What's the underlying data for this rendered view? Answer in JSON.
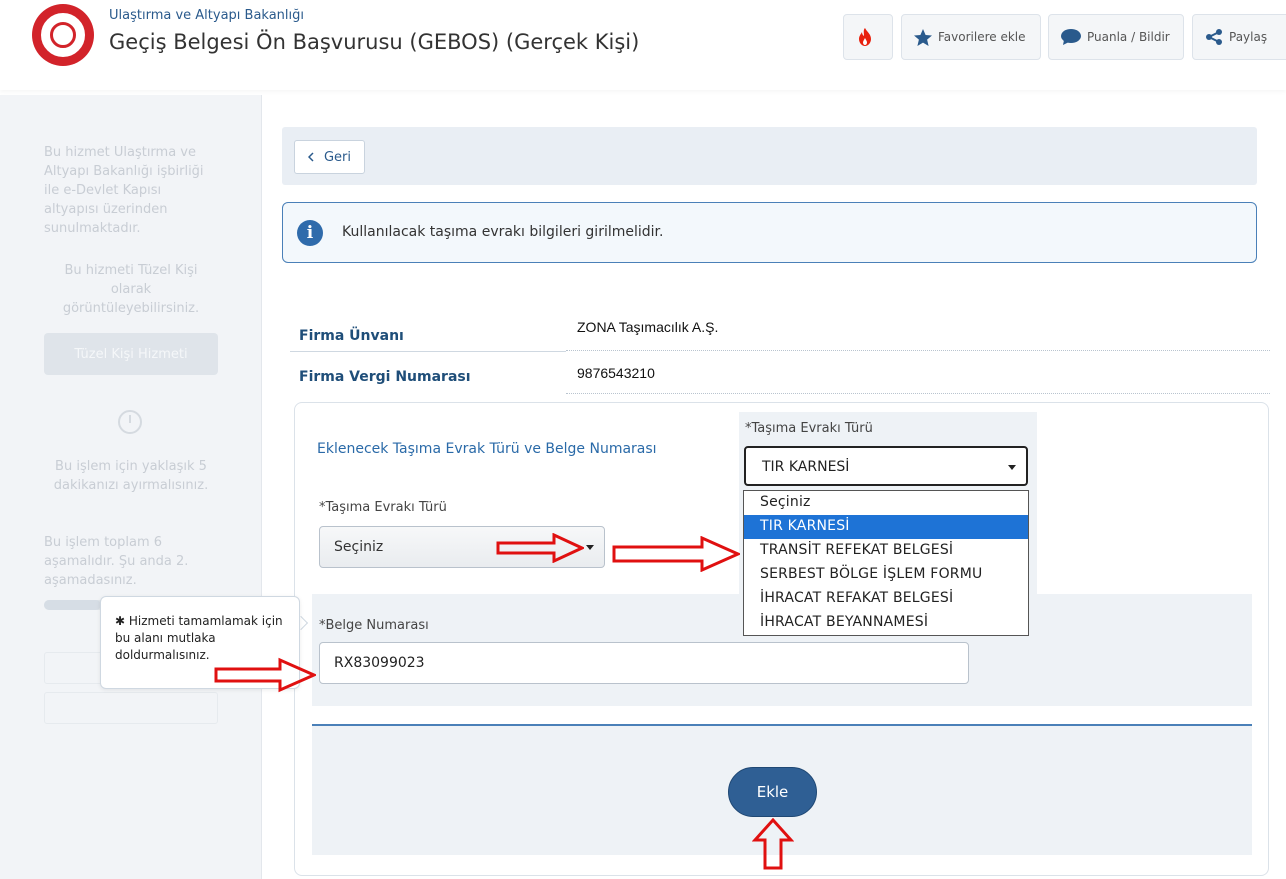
{
  "header": {
    "ministry": "Ulaştırma ve Altyapı Bakanlığı",
    "title": "Geçiş Belgesi Ön Başvurusu (GEBOS) (Gerçek Kişi)",
    "buttons": {
      "favorite": "Favorilere ekle",
      "rate": "Puanla / Bildir",
      "share": "Paylaş"
    }
  },
  "sidebar": {
    "intro": "Bu hizmet Ulaştırma ve Altyapı Bakanlığı işbirliği ile e-Devlet Kapısı altyapısı üzerinden sunulmaktadır.",
    "tuzel_text": "Bu hizmeti Tüzel Kişi olarak görüntüleyebilirsiniz.",
    "tuzel_button": "Tüzel Kişi Hizmeti",
    "time_text": "Bu işlem için yaklaşık 5 dakikanızı ayırmalısınız.",
    "steps_text": "Bu işlem toplam 6 aşamalıdır. Şu anda 2. aşamadasınız.",
    "progress": 0.33
  },
  "main": {
    "back_label": "Geri",
    "info_text": "Kullanılacak taşıma evrakı bilgileri girilmelidir.",
    "firm_name_label": "Firma Ünvanı",
    "firm_name_value": "ZONA Taşımacılık A.Ş.",
    "firm_tax_label": "Firma Vergi Numarası",
    "firm_tax_value": "9876543210",
    "panel_title": "Eklenecek Taşıma Evrak Türü ve Belge Numarası",
    "doc_type_label": "*Taşıma Evrakı Türü",
    "doc_type_value": "Seçiniz",
    "doc_number_label": "*Belge Numarası",
    "doc_number_value": "RX83099023",
    "add_button": "Ekle"
  },
  "popup": {
    "label": "*Taşıma Evrakı Türü",
    "selected": "TIR KARNESİ",
    "options": [
      "Seçiniz",
      "TIR KARNESİ",
      "TRANSİT REFEKAT BELGESİ",
      "SERBEST BÖLGE İŞLEM FORMU",
      "İHRACAT REFAKAT BELGESİ",
      "İHRACAT BEYANNAMESİ"
    ]
  },
  "tooltip": {
    "star": "✱",
    "text": "Hizmeti tamamlamak için bu alanı mutlaka doldurmalısınız."
  },
  "colors": {
    "primary": "#2f5f94",
    "accent_blue": "#1e73d6",
    "annotation_red": "#e01010",
    "info_border": "#4a80b8"
  }
}
